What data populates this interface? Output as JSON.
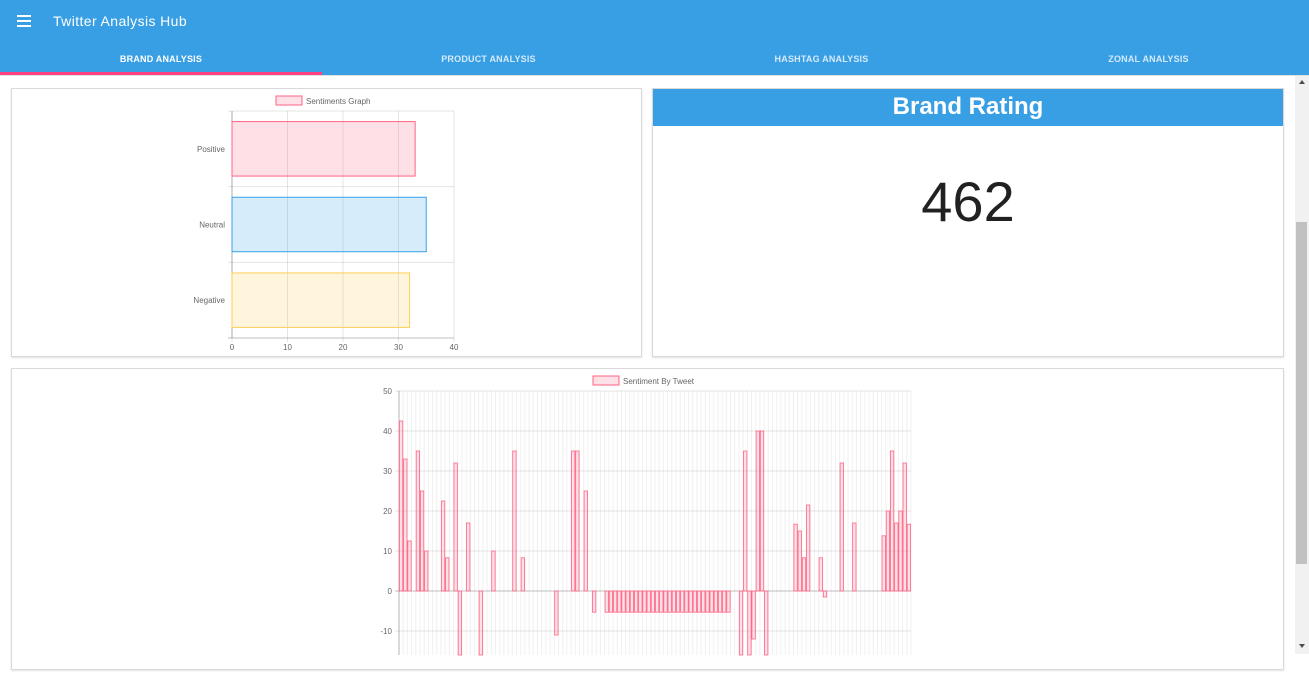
{
  "app": {
    "title": "Twitter Analysis Hub",
    "menu_icon": "menu-icon"
  },
  "tabs": [
    {
      "label": "BRAND ANALYSIS",
      "active": true
    },
    {
      "label": "PRODUCT ANALYSIS",
      "active": false
    },
    {
      "label": "HASHTAG ANALYSIS",
      "active": false
    },
    {
      "label": "ZONAL ANALYSIS",
      "active": false
    }
  ],
  "colors": {
    "appbar": "#389fe5",
    "indicator": "#ff4081",
    "bar_pink": "#ff6384",
    "bar_blue": "#36a2eb",
    "bar_yellow": "#ffce56"
  },
  "rating": {
    "title": "Brand Rating",
    "value": "462"
  },
  "chart_data": [
    {
      "type": "bar",
      "orientation": "horizontal",
      "legend": "Sentiments Graph",
      "legend_position": "top",
      "categories": [
        "Positive",
        "Neutral",
        "Negative"
      ],
      "values": [
        33,
        35,
        32
      ],
      "xlim": [
        0,
        40
      ],
      "x_ticks": [
        "0",
        "10",
        "20",
        "30",
        "40"
      ],
      "grid": true
    },
    {
      "type": "bar",
      "legend": "Sentiment By Tweet",
      "legend_position": "top",
      "ylim": [
        -16,
        50
      ],
      "y_ticks": [
        "50",
        "40",
        "30",
        "20",
        "10",
        "0",
        "-10"
      ],
      "grid": true,
      "values": [
        42.5,
        33,
        12.5,
        0,
        35,
        25,
        10,
        0,
        0,
        0,
        22.5,
        8.3,
        0,
        32,
        -16,
        0,
        17,
        0,
        0,
        -16,
        0,
        0,
        10,
        0,
        0,
        0,
        0,
        35,
        0,
        8.3,
        0,
        0,
        0,
        0,
        0,
        0,
        0,
        -11,
        0,
        0,
        0,
        35,
        35,
        0,
        25,
        0,
        -5.3,
        0,
        0,
        -5.3,
        -5.3,
        -5.3,
        -5.3,
        -5.3,
        -5.3,
        -5.3,
        -5.3,
        -5.3,
        -5.3,
        -5.3,
        -5.3,
        -5.3,
        -5.3,
        -5.3,
        -5.3,
        -5.3,
        -5.3,
        -5.3,
        -5.3,
        -5.3,
        -5.3,
        -5.3,
        -5.3,
        -5.3,
        -5.3,
        -5.3,
        -5.3,
        -5.3,
        -5.3,
        0,
        0,
        -16,
        35,
        -16,
        -12,
        40,
        40,
        -16,
        0,
        0,
        0,
        0,
        0,
        0,
        16.7,
        15,
        8.3,
        21.5,
        0,
        0,
        8.3,
        -1.5,
        0,
        0,
        0,
        32,
        0,
        0,
        17,
        0,
        0,
        0,
        0,
        0,
        0,
        13.8,
        20,
        35,
        17,
        20,
        32,
        16.7
      ]
    }
  ]
}
